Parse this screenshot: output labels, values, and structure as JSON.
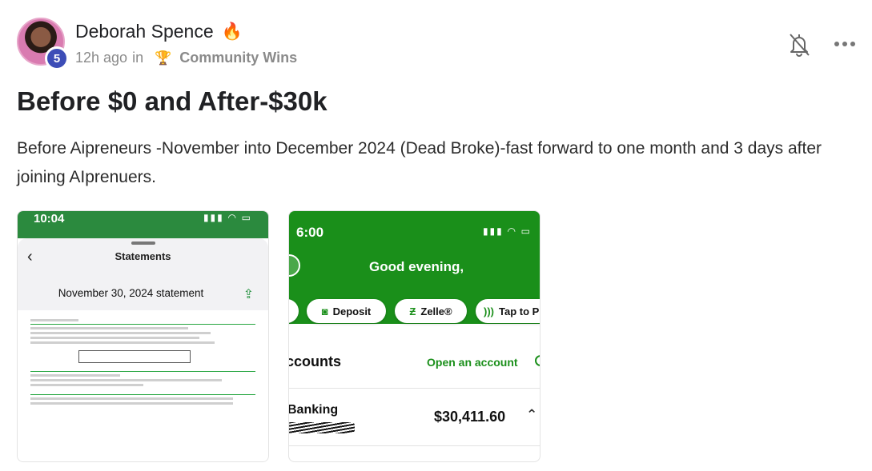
{
  "author": {
    "name": "Deborah Spence",
    "flair_icon": "fire-icon",
    "level": "5",
    "time_ago": "12h ago",
    "in_label": "in",
    "community_icon": "trophy-icon",
    "community": "Community Wins"
  },
  "actions": {
    "notify_icon": "bell-off-icon",
    "more_icon": "more-horizontal-icon"
  },
  "post": {
    "title": "Before $0 and After-$30k",
    "body": "Before Aipreneurs -November into December 2024 (Dead Broke)-fast forward to one month and 3 days after joining AIprenuers."
  },
  "images": [
    {
      "status_time": "10:04",
      "sheet_title": "Statements",
      "statement_label": "November 30, 2024 statement"
    },
    {
      "status_time": "6:00",
      "greeting": "Good evening,",
      "quick_actions": [
        "Deposit",
        "Zelle®",
        "Tap to P"
      ],
      "accounts_heading": "ccounts",
      "open_account": "Open an account",
      "account_name": "Banking",
      "balance": "$30,411.60"
    }
  ],
  "colors": {
    "level_badge": "#3d4db7",
    "bank_green": "#1a8f1a",
    "muted_text": "#8a8a8a"
  }
}
